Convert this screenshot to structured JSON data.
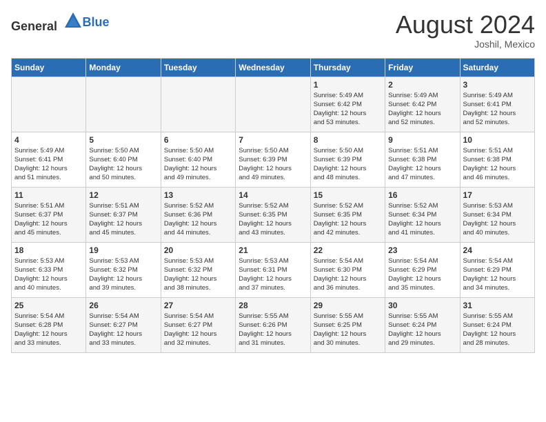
{
  "header": {
    "logo_general": "General",
    "logo_blue": "Blue",
    "month_year": "August 2024",
    "location": "Joshil, Mexico"
  },
  "days_of_week": [
    "Sunday",
    "Monday",
    "Tuesday",
    "Wednesday",
    "Thursday",
    "Friday",
    "Saturday"
  ],
  "weeks": [
    [
      {
        "day": "",
        "info": ""
      },
      {
        "day": "",
        "info": ""
      },
      {
        "day": "",
        "info": ""
      },
      {
        "day": "",
        "info": ""
      },
      {
        "day": "1",
        "info": "Sunrise: 5:49 AM\nSunset: 6:42 PM\nDaylight: 12 hours\nand 53 minutes."
      },
      {
        "day": "2",
        "info": "Sunrise: 5:49 AM\nSunset: 6:42 PM\nDaylight: 12 hours\nand 52 minutes."
      },
      {
        "day": "3",
        "info": "Sunrise: 5:49 AM\nSunset: 6:41 PM\nDaylight: 12 hours\nand 52 minutes."
      }
    ],
    [
      {
        "day": "4",
        "info": "Sunrise: 5:49 AM\nSunset: 6:41 PM\nDaylight: 12 hours\nand 51 minutes."
      },
      {
        "day": "5",
        "info": "Sunrise: 5:50 AM\nSunset: 6:40 PM\nDaylight: 12 hours\nand 50 minutes."
      },
      {
        "day": "6",
        "info": "Sunrise: 5:50 AM\nSunset: 6:40 PM\nDaylight: 12 hours\nand 49 minutes."
      },
      {
        "day": "7",
        "info": "Sunrise: 5:50 AM\nSunset: 6:39 PM\nDaylight: 12 hours\nand 49 minutes."
      },
      {
        "day": "8",
        "info": "Sunrise: 5:50 AM\nSunset: 6:39 PM\nDaylight: 12 hours\nand 48 minutes."
      },
      {
        "day": "9",
        "info": "Sunrise: 5:51 AM\nSunset: 6:38 PM\nDaylight: 12 hours\nand 47 minutes."
      },
      {
        "day": "10",
        "info": "Sunrise: 5:51 AM\nSunset: 6:38 PM\nDaylight: 12 hours\nand 46 minutes."
      }
    ],
    [
      {
        "day": "11",
        "info": "Sunrise: 5:51 AM\nSunset: 6:37 PM\nDaylight: 12 hours\nand 45 minutes."
      },
      {
        "day": "12",
        "info": "Sunrise: 5:51 AM\nSunset: 6:37 PM\nDaylight: 12 hours\nand 45 minutes."
      },
      {
        "day": "13",
        "info": "Sunrise: 5:52 AM\nSunset: 6:36 PM\nDaylight: 12 hours\nand 44 minutes."
      },
      {
        "day": "14",
        "info": "Sunrise: 5:52 AM\nSunset: 6:35 PM\nDaylight: 12 hours\nand 43 minutes."
      },
      {
        "day": "15",
        "info": "Sunrise: 5:52 AM\nSunset: 6:35 PM\nDaylight: 12 hours\nand 42 minutes."
      },
      {
        "day": "16",
        "info": "Sunrise: 5:52 AM\nSunset: 6:34 PM\nDaylight: 12 hours\nand 41 minutes."
      },
      {
        "day": "17",
        "info": "Sunrise: 5:53 AM\nSunset: 6:34 PM\nDaylight: 12 hours\nand 40 minutes."
      }
    ],
    [
      {
        "day": "18",
        "info": "Sunrise: 5:53 AM\nSunset: 6:33 PM\nDaylight: 12 hours\nand 40 minutes."
      },
      {
        "day": "19",
        "info": "Sunrise: 5:53 AM\nSunset: 6:32 PM\nDaylight: 12 hours\nand 39 minutes."
      },
      {
        "day": "20",
        "info": "Sunrise: 5:53 AM\nSunset: 6:32 PM\nDaylight: 12 hours\nand 38 minutes."
      },
      {
        "day": "21",
        "info": "Sunrise: 5:53 AM\nSunset: 6:31 PM\nDaylight: 12 hours\nand 37 minutes."
      },
      {
        "day": "22",
        "info": "Sunrise: 5:54 AM\nSunset: 6:30 PM\nDaylight: 12 hours\nand 36 minutes."
      },
      {
        "day": "23",
        "info": "Sunrise: 5:54 AM\nSunset: 6:29 PM\nDaylight: 12 hours\nand 35 minutes."
      },
      {
        "day": "24",
        "info": "Sunrise: 5:54 AM\nSunset: 6:29 PM\nDaylight: 12 hours\nand 34 minutes."
      }
    ],
    [
      {
        "day": "25",
        "info": "Sunrise: 5:54 AM\nSunset: 6:28 PM\nDaylight: 12 hours\nand 33 minutes."
      },
      {
        "day": "26",
        "info": "Sunrise: 5:54 AM\nSunset: 6:27 PM\nDaylight: 12 hours\nand 33 minutes."
      },
      {
        "day": "27",
        "info": "Sunrise: 5:54 AM\nSunset: 6:27 PM\nDaylight: 12 hours\nand 32 minutes."
      },
      {
        "day": "28",
        "info": "Sunrise: 5:55 AM\nSunset: 6:26 PM\nDaylight: 12 hours\nand 31 minutes."
      },
      {
        "day": "29",
        "info": "Sunrise: 5:55 AM\nSunset: 6:25 PM\nDaylight: 12 hours\nand 30 minutes."
      },
      {
        "day": "30",
        "info": "Sunrise: 5:55 AM\nSunset: 6:24 PM\nDaylight: 12 hours\nand 29 minutes."
      },
      {
        "day": "31",
        "info": "Sunrise: 5:55 AM\nSunset: 6:24 PM\nDaylight: 12 hours\nand 28 minutes."
      }
    ]
  ]
}
